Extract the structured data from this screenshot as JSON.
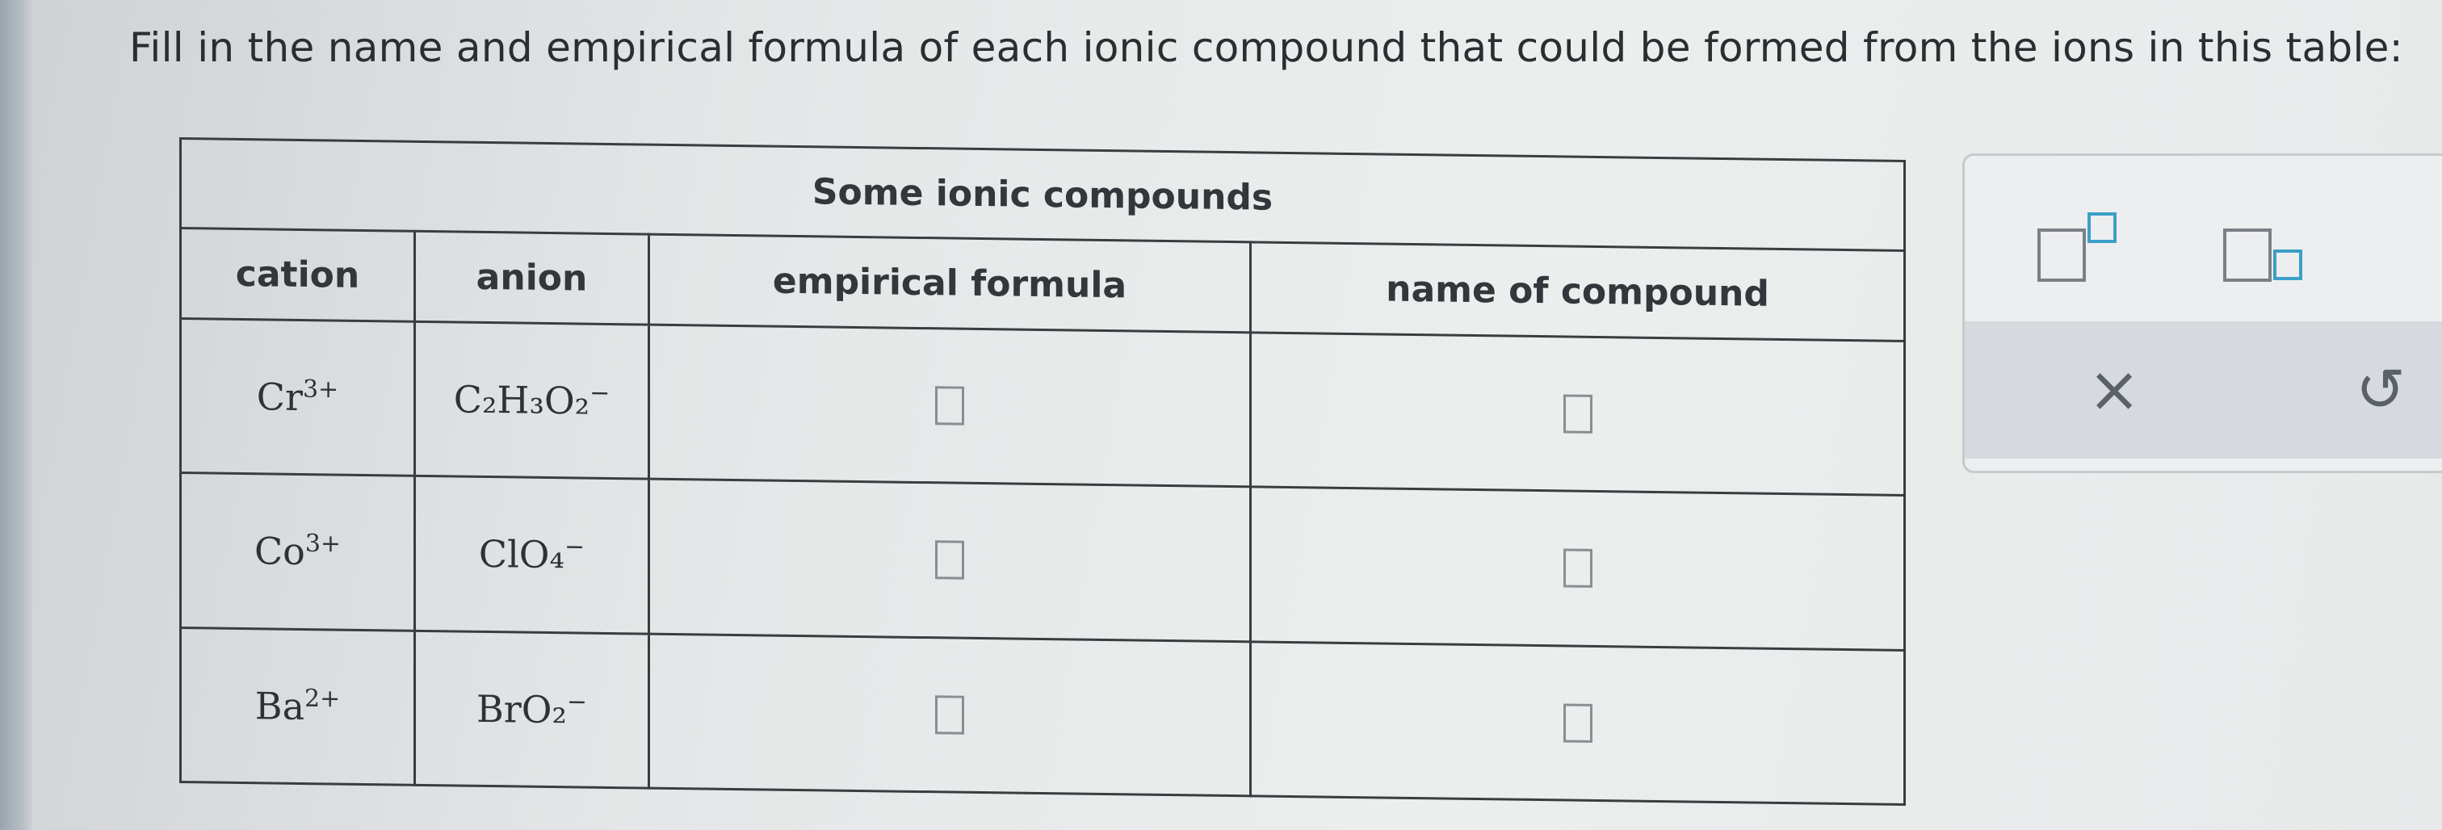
{
  "instruction": "Fill in the name and empirical formula of each ionic compound that could be formed from the ions in this table:",
  "table": {
    "title": "Some ionic compounds",
    "headers": [
      "cation",
      "anion",
      "empirical formula",
      "name of compound"
    ],
    "rows": [
      {
        "cation": {
          "base": "Cr",
          "charge": "3+"
        },
        "anion": {
          "text": "C₂H₃O₂",
          "charge": "−"
        }
      },
      {
        "cation": {
          "base": "Co",
          "charge": "3+"
        },
        "anion": {
          "text": "ClO₄",
          "charge": "−"
        }
      },
      {
        "cation": {
          "base": "Ba",
          "charge": "2+"
        },
        "anion": {
          "text": "BrO₂",
          "charge": "−"
        }
      }
    ]
  },
  "toolbar": {
    "superscript_icon": "superscript-template-icon",
    "subscript_icon": "subscript-template-icon",
    "clear_label": "×",
    "undo_label": "↺"
  },
  "colors": {
    "box_border": "#8a8d92",
    "accent": "#3ba0c8"
  }
}
